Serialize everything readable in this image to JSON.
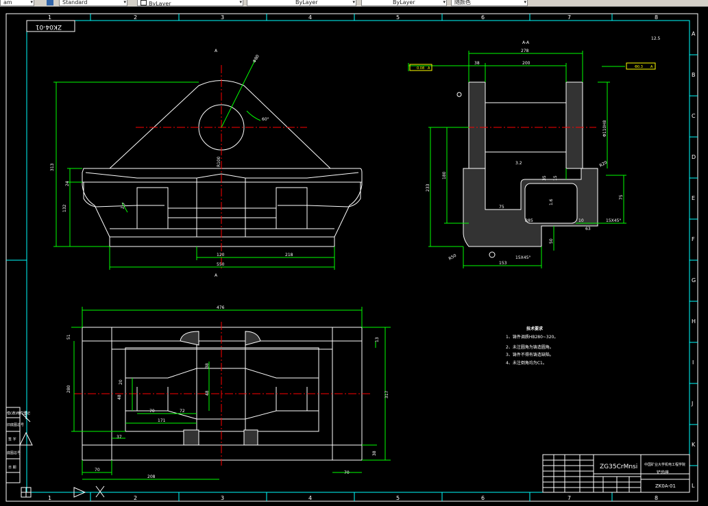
{
  "toolbar": {
    "unit_combo": "am",
    "text_style": "Standard",
    "layer": "ByLayer",
    "linetype": "ByLayer",
    "lineweight": "ByLayer",
    "plot_style": "随颜色"
  },
  "frame": {
    "col_labels": [
      "1",
      "2",
      "3",
      "4",
      "5",
      "6",
      "7",
      "8"
    ],
    "row_labels": [
      "A",
      "B",
      "C",
      "D",
      "E",
      "F",
      "G",
      "H",
      "I",
      "J",
      "K",
      "L"
    ],
    "drawing_no_mirrored": "ZK04-01"
  },
  "front_view": {
    "section_mark": "A",
    "dims": {
      "overall_height": "313",
      "top_height": "24",
      "lower_height": "132",
      "dia": "Φ80",
      "angle": "60°",
      "radius": "R100",
      "w_120": "120",
      "w_218": "218",
      "w_550": "550",
      "slope": "1:7"
    }
  },
  "section_view": {
    "title": "A-A",
    "roughness_note": "12.5",
    "tol_left": "0.08",
    "tol_left_ref": "A",
    "tol_right": "Φ0.3",
    "tol_right_ref": "A",
    "dims": {
      "w_278": "278",
      "w_38": "38",
      "w_200": "200",
      "h_233": "233",
      "h_180": "180",
      "d_110": "Φ110H8",
      "d_15": "15",
      "d_35": "35",
      "d_75": "75",
      "d_10": "10",
      "d_63": "63",
      "d_153": "153",
      "d_50": "50",
      "d_75b": "75",
      "thread": "15X45°",
      "r_85": "R85",
      "r_20": "R20",
      "chamfer": "15X45°",
      "r_50": "R50",
      "ra_32": "3.2",
      "ra_6": "1.6"
    }
  },
  "plan_view": {
    "dims": {
      "w_476": "476",
      "h_51": "51",
      "h_13": "13",
      "h_280": "280",
      "h_317": "317",
      "d_38": "38",
      "d_20": "20",
      "d_48": "48",
      "d_48b": "48",
      "d_70": "70",
      "d_72": "72",
      "d_171": "171",
      "d_37": "37",
      "d_70b": "70",
      "d_208": "208",
      "d_70c": "70",
      "d_38b": "38"
    }
  },
  "tech_notes": {
    "title": "技术要求",
    "items": [
      "1、铸件调质HB280~320。",
      "2、未注圆角为铸造圆角。",
      "3、铸件不得有铸造缺陷。",
      "4、未注倒角均为C1。"
    ]
  },
  "title_block": {
    "material": "ZG35CrMnsi",
    "company": "中国矿业大学机电工程学院",
    "part_name": "铲齿座",
    "drawing_no": "ZK0A-01"
  },
  "revision_panel": {
    "rows": [
      "借(通)用件登记",
      "旧底图总号",
      "底图总号",
      "签 字",
      "日 期"
    ]
  },
  "colors": {
    "white": "#ffffff",
    "cyan": "#00ffff",
    "green": "#00ff00",
    "red": "#ff0000",
    "yellow": "#ffff00",
    "magenta": "#ff00ff"
  }
}
